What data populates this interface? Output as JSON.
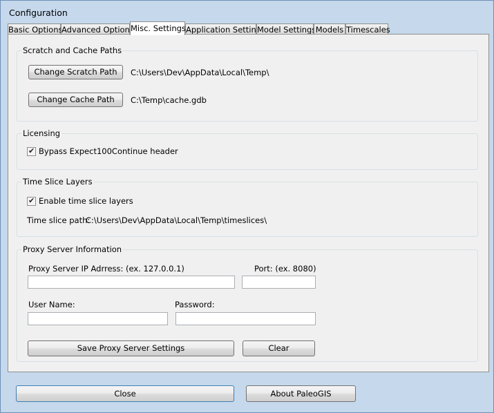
{
  "window": {
    "title": "Configuration"
  },
  "tabs": [
    "Basic Options",
    "Advanced Options",
    "Misc. Settings",
    "Application Settings",
    "Model Settings",
    "Models",
    "Timescales"
  ],
  "active_tab": "Misc. Settings",
  "scratch_cache": {
    "legend": "Scratch and Cache Paths",
    "change_scratch_label": "Change Scratch Path",
    "scratch_path": "C:\\Users\\Dev\\AppData\\Local\\Temp\\",
    "change_cache_label": "Change Cache Path",
    "cache_path": "C:\\Temp\\cache.gdb"
  },
  "licensing": {
    "legend": "Licensing",
    "bypass_label": "Bypass Expect100Continue header",
    "bypass_checked": true
  },
  "time_slice": {
    "legend": "Time Slice Layers",
    "enable_label": "Enable time slice layers",
    "enable_checked": true,
    "path_label": "Time slice path:",
    "path_value": "C:\\Users\\Dev\\AppData\\Local\\Temp\\timeslices\\"
  },
  "proxy": {
    "legend": "Proxy Server Information",
    "ip_label": "Proxy Server IP Adrress: (ex. 127.0.0.1)",
    "ip_value": "",
    "port_label": "Port: (ex. 8080)",
    "port_value": "",
    "user_label": "User Name:",
    "user_value": "",
    "password_label": "Password:",
    "password_value": "",
    "save_label": "Save Proxy Server Settings",
    "clear_label": "Clear"
  },
  "footer": {
    "close_label": "Close",
    "about_label": "About PaleoGIS"
  }
}
